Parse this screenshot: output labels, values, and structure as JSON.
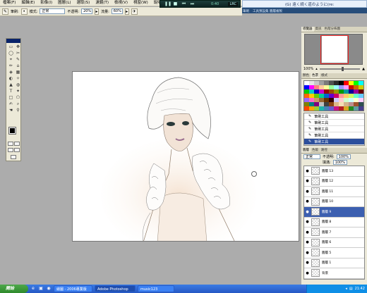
{
  "menubar": {
    "items": [
      "檔案(F)",
      "編輯(E)",
      "影像(I)",
      "圖層(L)",
      "選取(S)",
      "濾鏡(T)",
      "檢視(V)",
      "視窗(W)",
      "說明(H)"
    ]
  },
  "media_bar": {
    "time": "0:40",
    "mode": "LRC"
  },
  "video_window": {
    "title": "(G)  遠く続く道のように(re:",
    "tabs": [
      "筆刷",
      "工具預設集",
      "圖層複製"
    ]
  },
  "options_bar": {
    "brush_label": "筆刷:",
    "mode_label": "模式:",
    "mode_value": "正常",
    "opacity_label": "不透明:",
    "opacity_value": "20%",
    "flow_label": "流量:",
    "flow_value": "60%"
  },
  "toolbox": {
    "tools": [
      "▭",
      "✥",
      "◯",
      "✂",
      "⌖",
      "✎",
      "✏",
      "⌂",
      "◈",
      "▦",
      "◐",
      "✧",
      "▲",
      "◍",
      "T",
      "✦",
      "□",
      "⬠",
      "✍",
      "⌕",
      "☚",
      "⚲"
    ]
  },
  "navigator": {
    "tabs": [
      "導覽器",
      "資訊",
      "色階分佈圖"
    ],
    "zoom": "100%"
  },
  "swatches": {
    "tabs": [
      "顏色",
      "色票",
      "樣式"
    ],
    "colors": [
      "#ffffff",
      "#e6e6e6",
      "#c8c8c8",
      "#a0a0a0",
      "#7a7a7a",
      "#505050",
      "#2a2a2a",
      "#000000",
      "#ff0000",
      "#ffff00",
      "#00ff00",
      "#00ffff",
      "#0000ff",
      "#ff00ff",
      "#ff8080",
      "#ffcc99",
      "#ffff99",
      "#99ff99",
      "#99ffff",
      "#9999ff",
      "#ff99ff",
      "#cc0000",
      "#cc6600",
      "#cccc00",
      "#00cc00",
      "#00cccc",
      "#0000cc",
      "#cc00cc",
      "#990000",
      "#994c00",
      "#999900",
      "#009900",
      "#009999",
      "#000099",
      "#990099",
      "#660000",
      "#ff6600",
      "#ffcc00",
      "#66cc00",
      "#00cc99",
      "#0066cc",
      "#6600cc",
      "#cc0066",
      "#ff9999",
      "#ffcc66",
      "#ccff66",
      "#66ffcc",
      "#66ccff",
      "#9966ff",
      "#ff66cc",
      "#cc9966",
      "#996633",
      "#663300",
      "#330000",
      "#ccccff",
      "#ffcccc",
      "#ccffcc",
      "#ccffff",
      "#ffffcc",
      "#ffccff",
      "#808000",
      "#008080",
      "#800080",
      "#c0c0c0",
      "#404040",
      "#8b4513",
      "#deb887",
      "#f5deb3",
      "#d2b48c",
      "#bc8f8f",
      "#a0522d",
      "#2f4f4f",
      "#ff4500",
      "#ffa500",
      "#9acd32",
      "#20b2aa",
      "#4682b4",
      "#6a5acd",
      "#c71585",
      "#b22222",
      "#daa520",
      "#228b22",
      "#5f9ea0",
      "#483d8b"
    ]
  },
  "history": {
    "items": [
      "筆刷工具",
      "筆刷工具",
      "筆刷工具",
      "筆刷工具",
      "筆刷工具"
    ],
    "active_index": 4
  },
  "layers": {
    "tabs": [
      "圖層",
      "色版",
      "路徑"
    ],
    "blend_mode": "正常",
    "opacity_label": "不透明:",
    "opacity": "100%",
    "fill_label": "填滿:",
    "fill": "100%",
    "rows": [
      "圖層 13",
      "圖層 12",
      "圖層 11",
      "圖層 10",
      "圖層 9",
      "圖層 8",
      "圖層 7",
      "圖層 6",
      "圖層 5",
      "圖層 1",
      "背景"
    ],
    "active_index": 4
  },
  "taskbar": {
    "start_label": "開始",
    "tasks": [
      "繪圖 - 2006專業版",
      "Adobe Photoshop",
      "music123"
    ],
    "active_task": 1,
    "clock": "21:42"
  },
  "colors": {
    "accent": "#2c4f9c",
    "taskbar": "#2658c4"
  }
}
